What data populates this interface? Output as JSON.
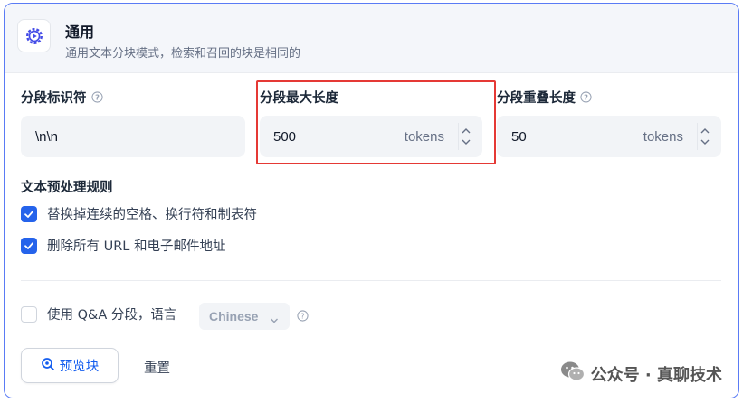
{
  "header": {
    "title": "通用",
    "description": "通用文本分块模式，检索和召回的块是相同的"
  },
  "fields": {
    "separator": {
      "label": "分段标识符",
      "value": "\\n\\n"
    },
    "max_length": {
      "label": "分段最大长度",
      "value": "500",
      "unit": "tokens"
    },
    "overlap": {
      "label": "分段重叠长度",
      "value": "50",
      "unit": "tokens"
    }
  },
  "preprocessing": {
    "title": "文本预处理规则",
    "rules": [
      {
        "label": "替换掉连续的空格、换行符和制表符",
        "checked": true
      },
      {
        "label": "删除所有 URL 和电子邮件地址",
        "checked": true
      }
    ]
  },
  "qa": {
    "label": "使用 Q&A 分段，语言",
    "checked": false,
    "language": "Chinese"
  },
  "actions": {
    "preview_label": "预览块",
    "reset_label": "重置"
  },
  "watermark": {
    "text": "公众号 · 真聊技术"
  },
  "colors": {
    "accent": "#2563eb",
    "highlight": "#e53935",
    "border": "#5a7bf5"
  }
}
